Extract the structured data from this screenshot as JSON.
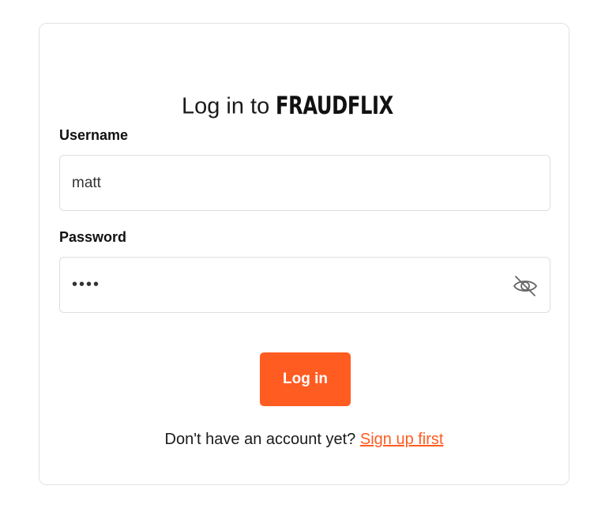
{
  "header": {
    "title_prefix": "Log in to",
    "brand_logo_text": "FRAUDFLIX"
  },
  "form": {
    "username": {
      "label": "Username",
      "value": "matt"
    },
    "password": {
      "label": "Password",
      "value": "••••",
      "toggle_icon": "eye-slash-icon"
    },
    "submit_label": "Log in"
  },
  "footer": {
    "prompt": "Don't have an account yet?",
    "signup_link": "Sign up first"
  },
  "colors": {
    "accent": "#ff5c22",
    "border": "#e2e2e2",
    "text": "#1a1a1a"
  }
}
